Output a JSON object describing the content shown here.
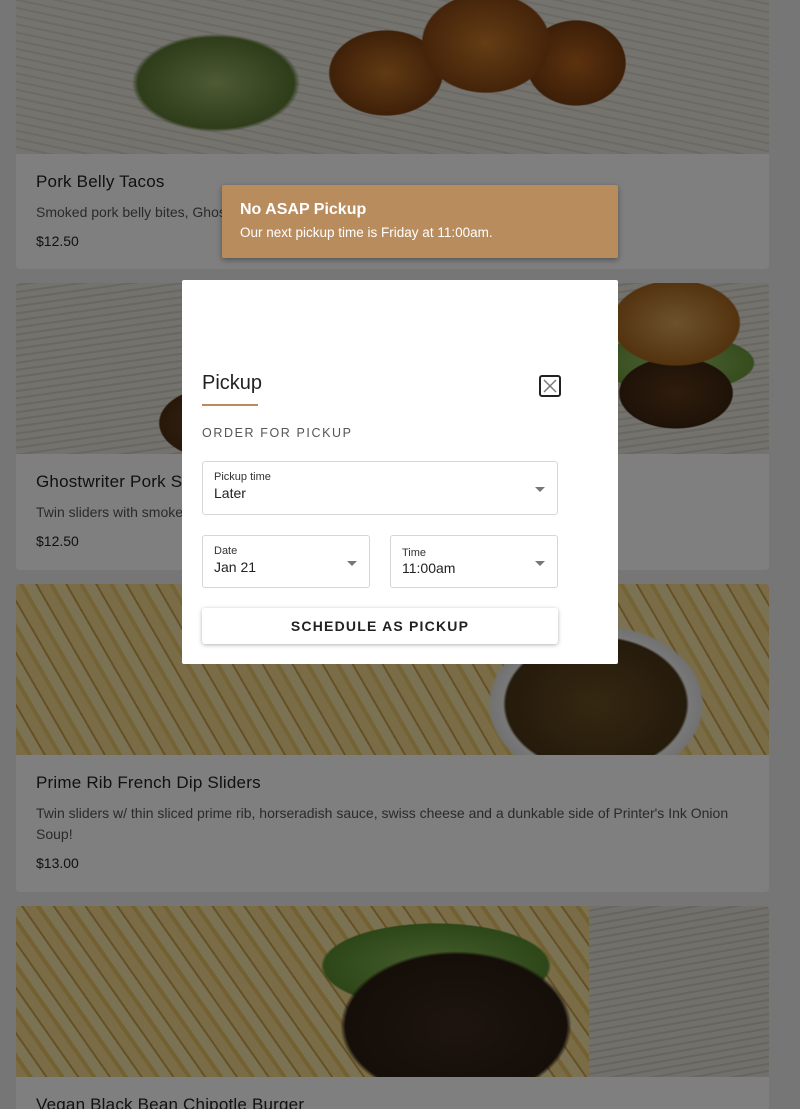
{
  "menu": {
    "items": [
      {
        "name": "Pork Belly Tacos",
        "description": "Smoked pork belly bites, Ghostwriter BBQ sauce and a crunchy Brussels sprout slaw",
        "price": "$12.50"
      },
      {
        "name": "Ghostwriter Pork Sliders",
        "description": "Twin sliders with smoked pulled pork, Ghostwriter BBQ sauce and slaw",
        "price": "$12.50"
      },
      {
        "name": "Prime Rib French Dip Sliders",
        "description": "Twin sliders w/ thin sliced prime rib, horseradish sauce, swiss cheese and a dunkable side of Printer's Ink Onion Soup!",
        "price": "$13.00"
      },
      {
        "name": "Vegan Black Bean Chipotle Burger",
        "description": "",
        "price": ""
      }
    ]
  },
  "toast": {
    "title": "No ASAP Pickup",
    "message": "Our next pickup time is Friday at 11:00am."
  },
  "modal": {
    "title": "Pickup",
    "section_label": "ORDER FOR PICKUP",
    "pickup_time": {
      "label": "Pickup time",
      "value": "Later"
    },
    "date": {
      "label": "Date",
      "value": "Jan 21"
    },
    "time": {
      "label": "Time",
      "value": "11:00am"
    },
    "schedule_button": "SCHEDULE AS PICKUP"
  },
  "colors": {
    "accent": "#b98c5e",
    "overlay": "rgba(0,0,0,0.5)"
  }
}
